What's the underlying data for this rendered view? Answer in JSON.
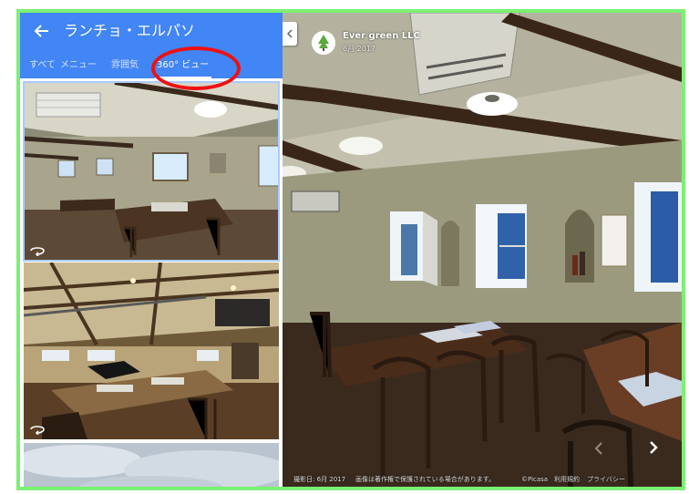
{
  "header": {
    "title": "ランチョ・エルパソ",
    "back_icon": "arrow-left-icon",
    "color": "#4285f4"
  },
  "tabs": [
    {
      "label": "すべて",
      "active": false
    },
    {
      "label": "メニュー",
      "active": false
    },
    {
      "label": "雰囲気",
      "active": false
    },
    {
      "label": "360° ビュー",
      "active": true
    }
  ],
  "annotation": {
    "circle_color": "#ee1111",
    "frame_color": "#7cf072"
  },
  "thumbnails": [
    {
      "name": "dining-room-panorama",
      "selected": true,
      "icon": "panorama-360-icon"
    },
    {
      "name": "hall-with-piano-panorama",
      "selected": false,
      "icon": "panorama-360-icon"
    },
    {
      "name": "sky-panorama",
      "selected": false,
      "icon": ""
    }
  ],
  "viewer": {
    "owner_name": "Ever green LLC",
    "owner_date": "6月 2017",
    "owner_avatar": "tree-logo-icon",
    "collapse_icon": "chevron-left-icon",
    "next_icon": "chevron-right-icon",
    "prev_icon": "chevron-left-icon"
  },
  "footer": {
    "captured": "撮影日: 6月 2017",
    "copyright": "画像は著作権で保護されている場合があります。",
    "provider": "©Picasa",
    "terms": "利用規約",
    "privacy": "プライバシー"
  }
}
